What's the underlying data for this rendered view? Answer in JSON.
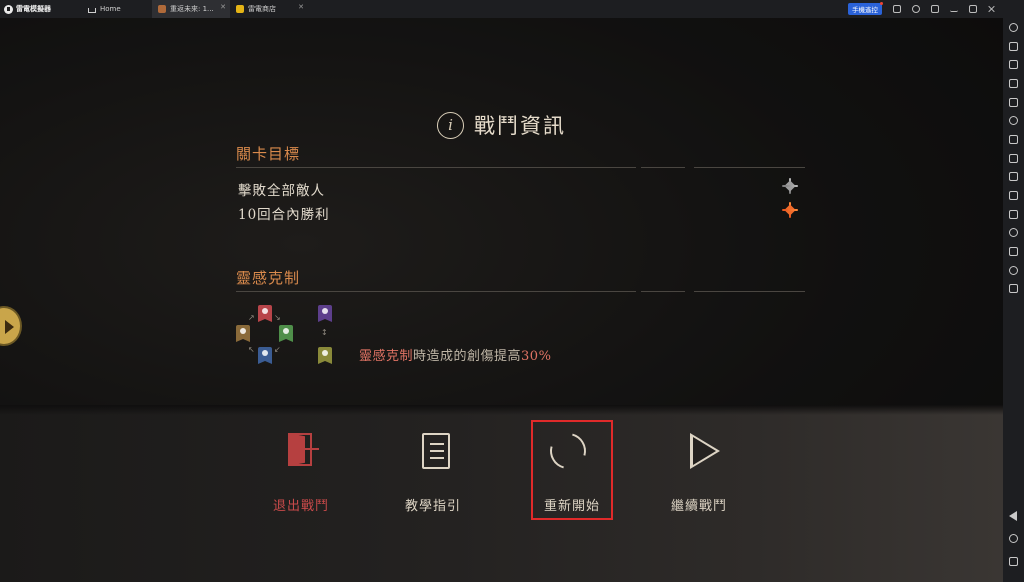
{
  "titlebar": {
    "app_name": "雷電模擬器",
    "tabs": [
      {
        "label": "Home"
      },
      {
        "label": "重返未來: 1..."
      },
      {
        "label": "雷電商店"
      }
    ],
    "remote_button": "手機遙控"
  },
  "battle_info": {
    "title": "戰鬥資訊",
    "objectives_heading": "關卡目標",
    "objectives": [
      {
        "text": "擊敗全部敵人"
      },
      {
        "text": "10回合內勝利"
      }
    ],
    "affinity_heading": "靈感克制",
    "affinity_prefix": "靈感克制",
    "affinity_middle": "時造成的創傷提高",
    "affinity_value": "30%"
  },
  "actions": [
    {
      "label": "退出戰鬥"
    },
    {
      "label": "教學指引"
    },
    {
      "label": "重新開始"
    },
    {
      "label": "繼續戰鬥"
    }
  ],
  "colors": {
    "accent_orange": "#d98a4c",
    "highlight_red": "#e07364",
    "selected_border": "#e02a2a",
    "exit_red": "#b64040"
  }
}
